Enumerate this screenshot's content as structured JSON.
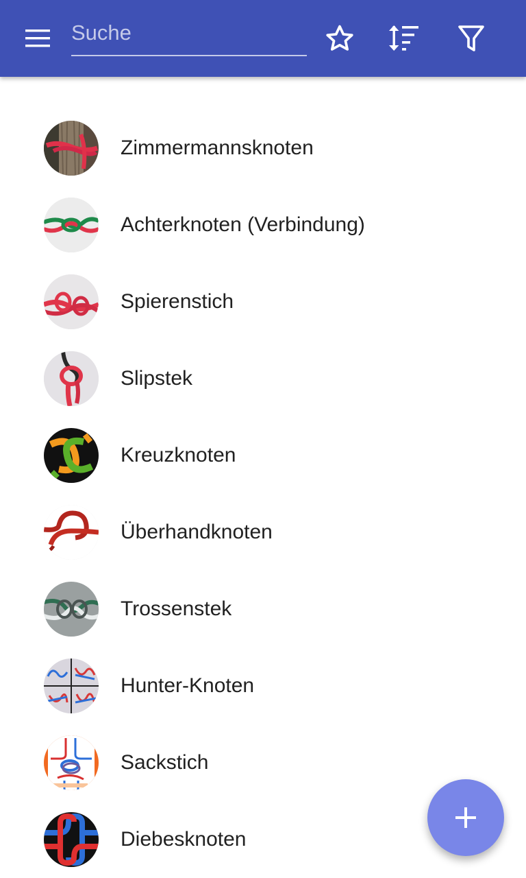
{
  "toolbar": {
    "menu_icon": "hamburger-menu-icon",
    "search_placeholder": "Suche",
    "search_value": "",
    "favorites_icon": "star-outline-icon",
    "sort_icon": "sort-icon",
    "filter_icon": "filter-icon",
    "background_color": "#3f51b5"
  },
  "knots": [
    {
      "name": "Zimmermannsknoten",
      "thumbnail": "red-rope-on-tree-trunk"
    },
    {
      "name": "Achterknoten (Verbindung)",
      "thumbnail": "green-red-figure-eight-knot"
    },
    {
      "name": "Spierenstich",
      "thumbnail": "red-rope-fishermans-knot"
    },
    {
      "name": "Slipstek",
      "thumbnail": "red-rope-slip-knot"
    },
    {
      "name": "Kreuzknoten",
      "thumbnail": "orange-green-square-knot-diagram"
    },
    {
      "name": "Überhandknoten",
      "thumbnail": "red-rope-overhand-knot"
    },
    {
      "name": "Trossenstek",
      "thumbnail": "green-grey-carrick-bend"
    },
    {
      "name": "Hunter-Knoten",
      "thumbnail": "blue-red-hunters-bend-steps"
    },
    {
      "name": "Sackstich",
      "thumbnail": "blue-red-sack-knot-diagram"
    },
    {
      "name": "Diebesknoten",
      "thumbnail": "blue-red-thief-knot-diagram"
    }
  ],
  "fab": {
    "icon": "plus-icon",
    "color": "#7986e8"
  }
}
